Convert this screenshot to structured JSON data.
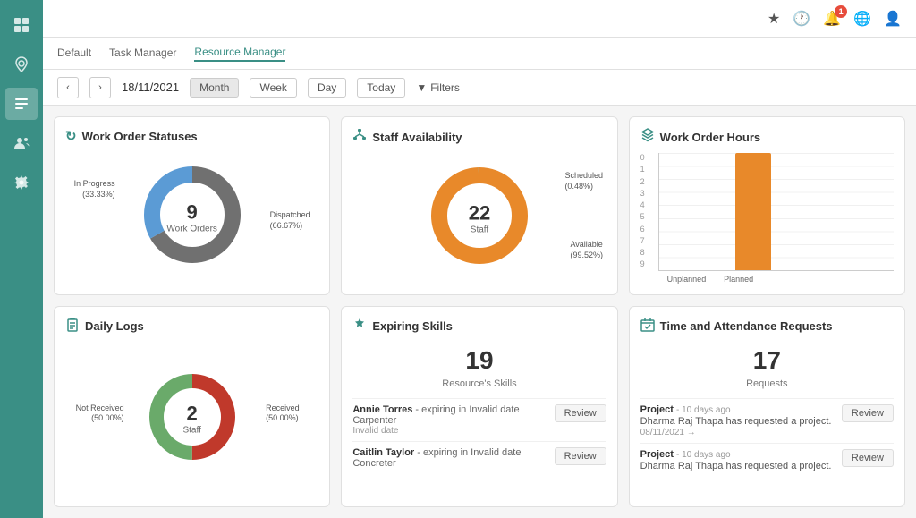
{
  "topbar": {
    "icons": [
      "star",
      "clock",
      "bell",
      "globe",
      "user"
    ],
    "notification_count": "1"
  },
  "tabs": [
    {
      "id": "default",
      "label": "Default",
      "active": false
    },
    {
      "id": "task-manager",
      "label": "Task Manager",
      "active": false
    },
    {
      "id": "resource-manager",
      "label": "Resource Manager",
      "active": true
    }
  ],
  "toolbar": {
    "date": "18/11/2021",
    "views": [
      "Month",
      "Week",
      "Day",
      "Today"
    ],
    "active_view": "Month",
    "filter_label": "Filters"
  },
  "work_order_statuses": {
    "title": "Work Order Statuses",
    "total": "9",
    "total_label": "Work Orders",
    "segments": [
      {
        "label": "In Progress\n(33.33%)",
        "value": 33.33,
        "color": "#5b9bd5"
      },
      {
        "label": "Dispatched\n(66.67%)",
        "value": 66.67,
        "color": "#707070"
      }
    ],
    "legend": [
      {
        "position": "left",
        "text": "In Progress\n(33.33%)"
      },
      {
        "position": "right",
        "text": "Dispatched\n(66.67%)"
      }
    ]
  },
  "staff_availability": {
    "title": "Staff Availability",
    "total": "22",
    "total_label": "Staff",
    "segments": [
      {
        "label": "Scheduled (0.48%)",
        "value": 0.48,
        "color": "#3a8f85"
      },
      {
        "label": "Available (99.52%)",
        "value": 99.52,
        "color": "#e8892a"
      }
    ],
    "legend": [
      {
        "position": "top-right",
        "text": "Scheduled\n(0.48%)"
      },
      {
        "position": "bottom-left",
        "text": "Available\n(99.52%)"
      }
    ]
  },
  "work_order_hours": {
    "title": "Work Order Hours",
    "y_axis": [
      "0",
      "1",
      "2",
      "3",
      "4",
      "5",
      "6",
      "7",
      "8",
      "9"
    ],
    "bars": [
      {
        "label": "Unplanned",
        "value": 0,
        "height_pct": 0,
        "color": "#e8892a"
      },
      {
        "label": "Planned",
        "value": 9,
        "height_pct": 100,
        "color": "#e8892a"
      }
    ]
  },
  "daily_logs": {
    "title": "Daily Logs",
    "total": "2",
    "total_label": "Staff",
    "segments": [
      {
        "label": "Not Received\n(50.00%)",
        "value": 50,
        "color": "#c0392b"
      },
      {
        "label": "Received\n(50.00%)",
        "value": 50,
        "color": "#6aaa6a"
      }
    ]
  },
  "expiring_skills": {
    "title": "Expiring Skills",
    "count": "19",
    "count_label": "Resource's Skills",
    "items": [
      {
        "name": "Annie Torres",
        "connector": " - expiring in Invalid date",
        "role": "Carpenter",
        "date": "Invalid date",
        "btn": "Review"
      },
      {
        "name": "Caitlin Taylor",
        "connector": " - expiring in Invalid date",
        "role": "Concreter",
        "date": "",
        "btn": "Review"
      }
    ]
  },
  "time_attendance": {
    "title": "Time and Attendance Requests",
    "count": "17",
    "count_label": "Requests",
    "items": [
      {
        "type": "Project",
        "time_ago": " - 10 days ago",
        "desc": "Dharma Raj Thapa has requested a project.",
        "date": "08/11/2021 →",
        "btn": "Review"
      },
      {
        "type": "Project",
        "time_ago": " - 10 days ago",
        "desc": "Dharma Raj Thapa has requested a project.",
        "date": "",
        "btn": "Review"
      }
    ]
  }
}
